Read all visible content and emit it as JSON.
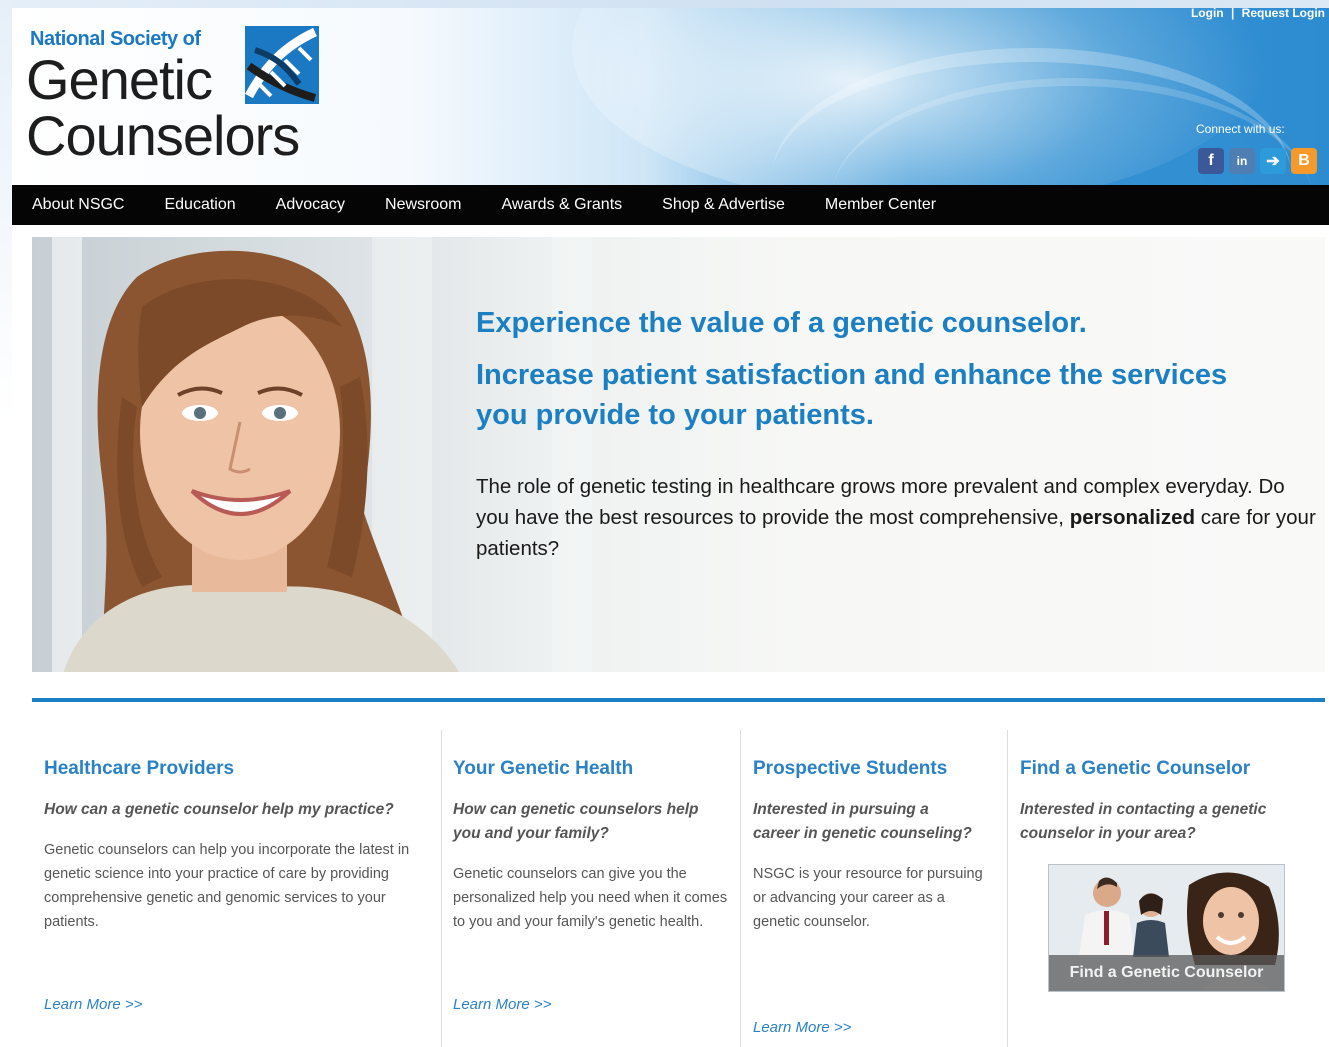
{
  "header": {
    "logo_pre": "National Society of",
    "logo_line1": "Genetic",
    "logo_line2": "Counselors",
    "login": "Login",
    "separator": "|",
    "request_login": "Request Login",
    "connect_label": "Connect with us:",
    "social": [
      {
        "name": "facebook-icon",
        "glyph": "f"
      },
      {
        "name": "linkedin-icon",
        "glyph": "in"
      },
      {
        "name": "twitter-icon",
        "glyph": "➔"
      },
      {
        "name": "blogger-icon",
        "glyph": "B"
      }
    ]
  },
  "nav": {
    "items": [
      "About NSGC",
      "Education",
      "Advocacy",
      "Newsroom",
      "Awards & Grants",
      "Shop & Advertise",
      "Member Center"
    ]
  },
  "hero": {
    "headline1": "Experience the value of a genetic counselor.",
    "headline2": "Increase patient satisfaction and enhance the services you provide to your patients.",
    "body_start": "The role of genetic testing in healthcare grows more prevalent and complex everyday. Do you have the best resources to provide the most comprehensive, ",
    "body_bold": "personalized",
    "body_end": " care for your patients?"
  },
  "columns": [
    {
      "title": "Healthcare Providers",
      "question": "How can a genetic counselor help my practice?",
      "description": "Genetic counselors can help you incorporate the latest in genetic science into your practice of care by providing comprehensive genetic and genomic services to your patients.",
      "link": "Learn More >>"
    },
    {
      "title": "Your Genetic Health",
      "question": "How can genetic counselors help you and your family?",
      "description": "Genetic counselors can give you the personalized help you need when it comes to you and your family's genetic health.",
      "link": "Learn More >>"
    },
    {
      "title": "Prospective Students",
      "question": "Interested in pursuing a career in genetic counseling?",
      "description": "NSGC is your resource for pursuing or advancing your career as a genetic counselor.",
      "link": "Learn More >>"
    },
    {
      "title": "Find a Genetic Counselor",
      "question": "Interested in contacting a genetic counselor in your area?",
      "image_caption": "Find a Genetic Counselor"
    }
  ],
  "colors": {
    "accent_blue": "#1c7fc1",
    "nav_black": "#050505",
    "rule_blue": "#1b7fc3"
  }
}
